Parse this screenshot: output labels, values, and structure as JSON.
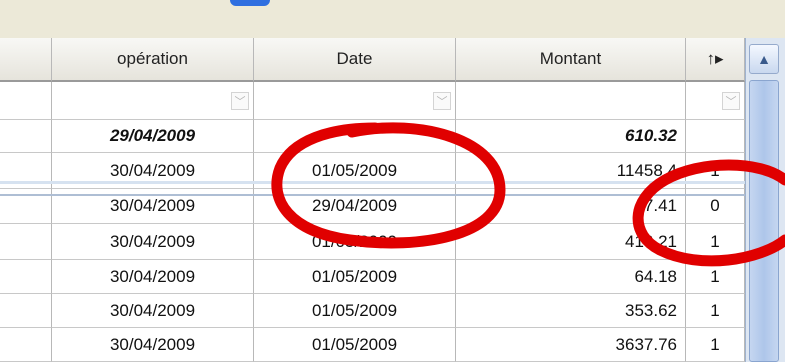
{
  "headers": [
    "",
    "opération",
    "Date",
    "Montant",
    "↑▸"
  ],
  "summary_row": {
    "operation": "29/04/2009",
    "date": "",
    "montant": "610.32",
    "flag": ""
  },
  "rows": [
    {
      "operation": "30/04/2009",
      "date": "01/05/2009",
      "montant": "11458.4",
      "flag": "1"
    },
    {
      "operation": "30/04/2009",
      "date": "29/04/2009",
      "montant": "7.41",
      "flag": "0"
    },
    {
      "operation": "30/04/2009",
      "date": "01/05/2009",
      "montant": "416.21",
      "flag": "1"
    },
    {
      "operation": "30/04/2009",
      "date": "01/05/2009",
      "montant": "64.18",
      "flag": "1"
    },
    {
      "operation": "30/04/2009",
      "date": "01/05/2009",
      "montant": "353.62",
      "flag": "1"
    },
    {
      "operation": "30/04/2009",
      "date": "01/05/2009",
      "montant": "3637.76",
      "flag": "1"
    }
  ],
  "colors": {
    "annotation": "#e00000",
    "header_bg": "#ece9d8",
    "scrollbar": "#aec6ea"
  }
}
